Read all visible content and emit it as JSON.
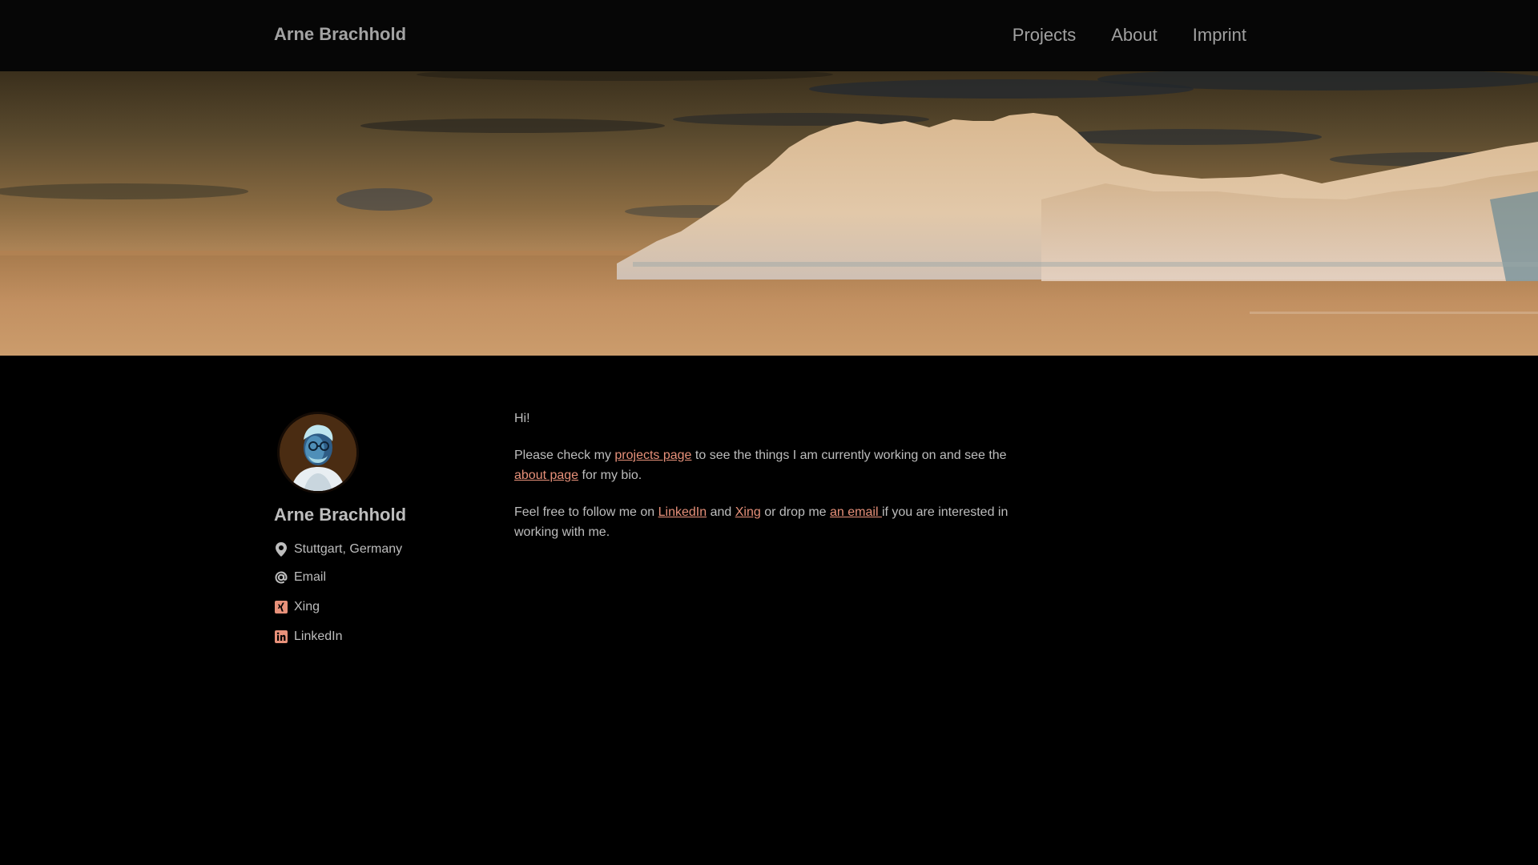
{
  "header": {
    "site_title": "Arne Brachhold",
    "nav": [
      {
        "label": "Projects"
      },
      {
        "label": "About"
      },
      {
        "label": "Imprint"
      }
    ]
  },
  "sidebar": {
    "name": "Arne Brachhold",
    "items": [
      {
        "label": "Stuttgart, Germany",
        "icon": "map-marker-icon"
      },
      {
        "label": "Email",
        "icon": "at-sign-icon"
      },
      {
        "label": "Xing",
        "icon": "xing-icon"
      },
      {
        "label": "LinkedIn",
        "icon": "linkedin-icon"
      }
    ]
  },
  "content": {
    "greeting": "Hi!",
    "p2": {
      "t1": "Please check my ",
      "link1": "projects page",
      "t2": " to see the things I am currently working on and see the ",
      "link2": "about page",
      "t3": " for my bio."
    },
    "p3": {
      "t1": "Feel free to follow me on ",
      "link1": "LinkedIn",
      "t2": " and ",
      "link2": "Xing",
      "t3": " or drop me ",
      "link3": "an email ",
      "t4": "if you are interested in working with me."
    }
  },
  "colors": {
    "background": "#000000",
    "link": "#e8917a",
    "icon_accent": "#e8917a",
    "text": "#bdbdbd"
  }
}
